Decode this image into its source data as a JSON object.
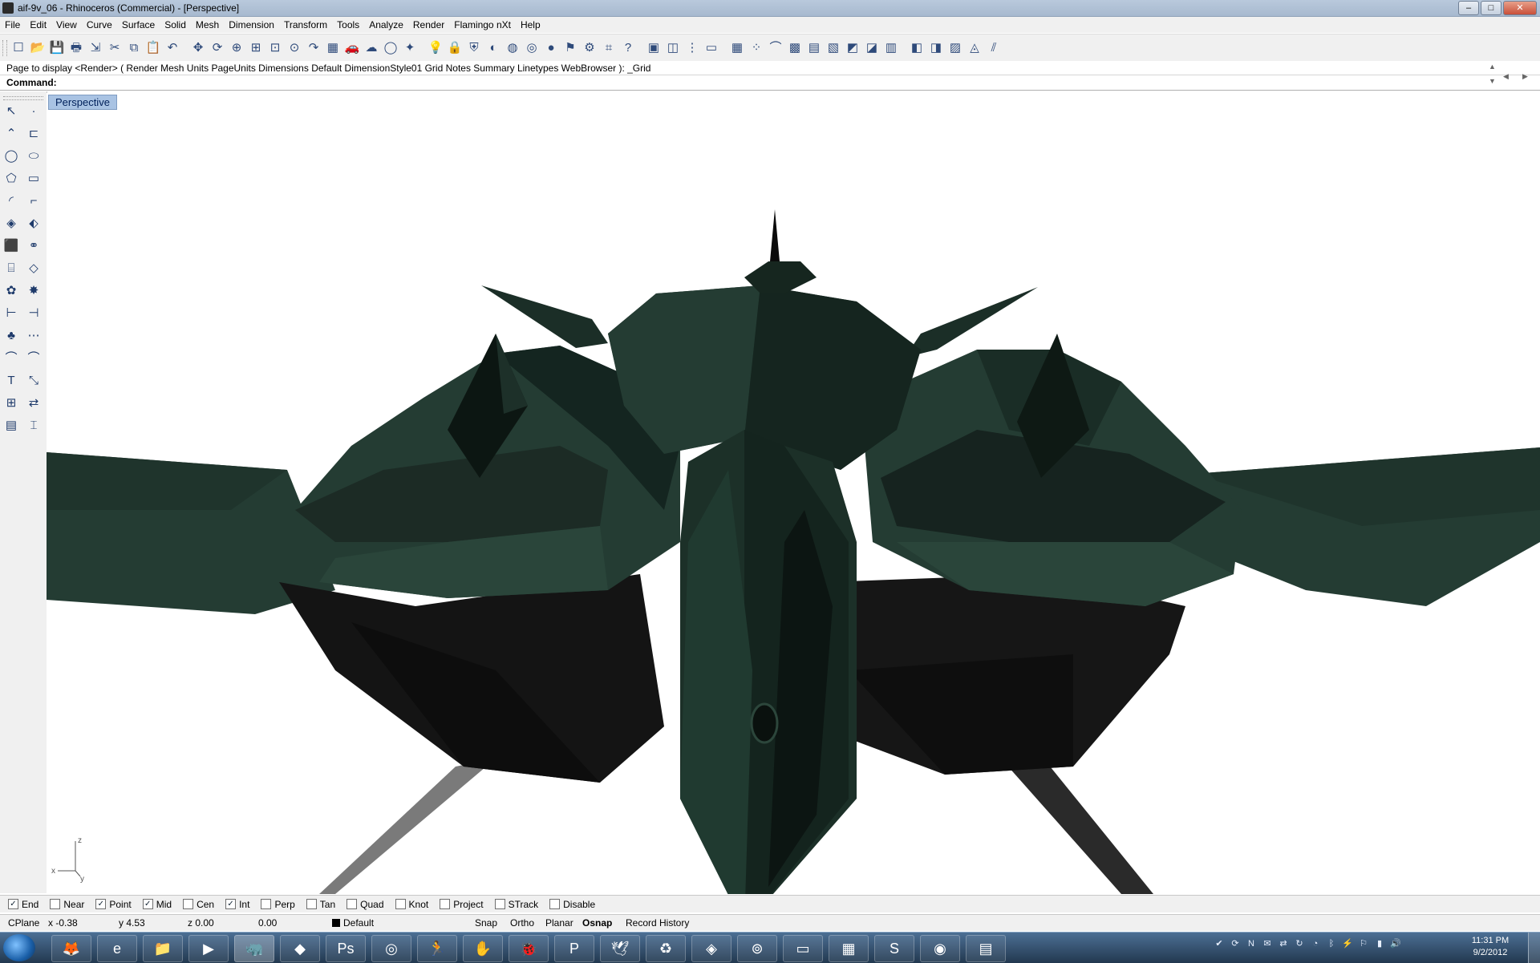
{
  "window": {
    "title": "aif-9v_06 - Rhinoceros (Commercial) - [Perspective]"
  },
  "menu": [
    "File",
    "Edit",
    "View",
    "Curve",
    "Surface",
    "Solid",
    "Mesh",
    "Dimension",
    "Transform",
    "Tools",
    "Analyze",
    "Render",
    "Flamingo nXt",
    "Help"
  ],
  "toolbar_icons": [
    "new-file-icon",
    "open-file-icon",
    "save-icon",
    "print-icon",
    "import-icon",
    "cut-icon",
    "copy-icon",
    "paste-icon",
    "undo-icon",
    "pan-icon",
    "rotate-view-icon",
    "zoom-dynamic-icon",
    "zoom-window-icon",
    "zoom-extents-icon",
    "zoom-selected-icon",
    "redo-view-icon",
    "viewport-layout-icon",
    "car-icon",
    "render-icon",
    "circle-icon",
    "osnap-icon",
    "light-icon",
    "lock-icon",
    "shield-icon",
    "color-wheel-icon",
    "sphere-wire-icon",
    "sphere-mesh-icon",
    "sphere-render-icon",
    "flag-icon",
    "gear-icon",
    "dimension-icon",
    "help-icon",
    "box-icon",
    "box-edit-icon",
    "pin-icon",
    "panel-icon",
    "grid-icon",
    "snap-points-icon",
    "curve-icon",
    "grid-dots-icon",
    "measure-icon",
    "book-icon",
    "surface-icon",
    "mesh-icon",
    "layout-icon",
    "cplane-icon",
    "analyze-icon",
    "draft-icon",
    "curvature-icon",
    "zebra-icon"
  ],
  "command": {
    "history": "Page to display <Render> ( Render  Mesh  Units  PageUnits  Dimensions  Default  DimensionStyle01  Grid  Notes  Summary  Linetypes  WebBrowser ): _Grid",
    "label": "Command:",
    "value": ""
  },
  "left_tools": [
    "select-arrow-icon",
    "point-icon",
    "polyline-icon",
    "curve-icon",
    "circle-icon",
    "ellipse-icon",
    "polygon-icon",
    "rectangle-icon",
    "arc-icon",
    "fillet-curve-icon",
    "surface-icon",
    "loft-icon",
    "box-solid-icon",
    "boolean-union-icon",
    "cylinder-icon",
    "extrude-icon",
    "gear-mesh-icon",
    "explode-icon",
    "trim-icon",
    "split-icon",
    "blob-icon",
    "group-icon",
    "curve-from-object-icon",
    "offset-icon",
    "text-icon",
    "scale-icon",
    "array-icon",
    "transform-icon",
    "block-icon",
    "dimension-tools-icon"
  ],
  "viewport": {
    "label": "Perspective",
    "axes": {
      "x": "x",
      "y": "y",
      "z": "z"
    }
  },
  "colors": {
    "model_dark": "#0f1a16",
    "model_green": "#243c33",
    "model_mid": "#1b2e27",
    "strut": "#6e6e6e"
  },
  "osnap": [
    {
      "label": "End",
      "checked": true
    },
    {
      "label": "Near",
      "checked": false
    },
    {
      "label": "Point",
      "checked": true
    },
    {
      "label": "Mid",
      "checked": true
    },
    {
      "label": "Cen",
      "checked": false
    },
    {
      "label": "Int",
      "checked": true
    },
    {
      "label": "Perp",
      "checked": false
    },
    {
      "label": "Tan",
      "checked": false
    },
    {
      "label": "Quad",
      "checked": false
    },
    {
      "label": "Knot",
      "checked": false
    },
    {
      "label": "Project",
      "checked": false
    },
    {
      "label": "STrack",
      "checked": false
    },
    {
      "label": "Disable",
      "checked": false
    }
  ],
  "status": {
    "cplane": "CPlane",
    "x": "x -0.38",
    "y": "y 4.53",
    "z": "z 0.00",
    "dist": "0.00",
    "layer": "Default",
    "snap": "Snap",
    "ortho": "Ortho",
    "planar": "Planar",
    "osnap": "Osnap",
    "record": "Record History"
  },
  "taskbar_apps": [
    {
      "icon": "firefox-icon",
      "glyph": "🦊"
    },
    {
      "icon": "internet-explorer-icon",
      "glyph": "e"
    },
    {
      "icon": "folder-icon",
      "glyph": "📁"
    },
    {
      "icon": "media-player-icon",
      "glyph": "▶"
    },
    {
      "icon": "rhino-icon",
      "glyph": "🦏"
    },
    {
      "icon": "sketchup-icon",
      "glyph": "◆"
    },
    {
      "icon": "photoshop-icon",
      "glyph": "Ps"
    },
    {
      "icon": "steam-icon",
      "glyph": "◎"
    },
    {
      "icon": "figure-icon",
      "glyph": "🏃"
    },
    {
      "icon": "hand-icon",
      "glyph": "✋"
    },
    {
      "icon": "ladybug-icon",
      "glyph": "🐞"
    },
    {
      "icon": "powerpoint-icon",
      "glyph": "P"
    },
    {
      "icon": "bird-icon",
      "glyph": "🕊"
    },
    {
      "icon": "recycle-icon",
      "glyph": "♻"
    },
    {
      "icon": "gems-icon",
      "glyph": "◈"
    },
    {
      "icon": "player-icon",
      "glyph": "⊚"
    },
    {
      "icon": "notebook-icon",
      "glyph": "▭"
    },
    {
      "icon": "calculator-icon",
      "glyph": "▦"
    },
    {
      "icon": "skype-icon",
      "glyph": "S"
    },
    {
      "icon": "video-icon",
      "glyph": "◉"
    },
    {
      "icon": "palette-icon",
      "glyph": "▤"
    }
  ],
  "tray_icons": [
    "tray-shield-icon",
    "tray-sync-icon",
    "tray-onenote-icon",
    "tray-chat-icon",
    "tray-network-share-icon",
    "tray-update-icon",
    "tray-globe-icon",
    "tray-bluetooth-icon",
    "tray-power-icon",
    "tray-flag-icon",
    "tray-signal-icon",
    "tray-volume-icon"
  ],
  "clock": {
    "time": "11:31 PM",
    "date": "9/2/2012"
  }
}
